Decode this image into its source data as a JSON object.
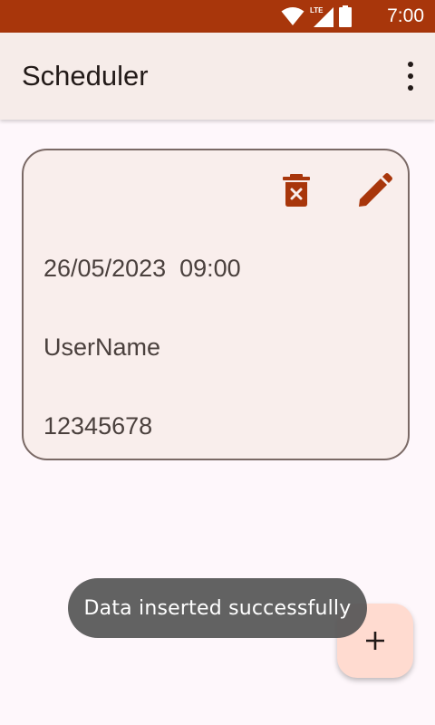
{
  "status_bar": {
    "time": "7:00",
    "network_label": "LTE",
    "background_color": "#a8360b",
    "icons": [
      "wifi-icon",
      "cellular-signal-icon",
      "battery-icon"
    ]
  },
  "app_bar": {
    "title": "Scheduler",
    "overflow_icon": "more-vert-icon"
  },
  "schedule_card": {
    "datetime": "26/05/2023  09:00",
    "username": "UserName",
    "phone": "12345678",
    "actions": {
      "delete_icon": "delete-icon",
      "edit_icon": "edit-pencil-icon"
    }
  },
  "fab": {
    "icon": "plus-icon"
  },
  "toast": {
    "message": "Data inserted successfully"
  },
  "colors": {
    "accent": "#a8360b",
    "card_background": "#f9eeec",
    "fab_background": "#ffdbd0"
  }
}
